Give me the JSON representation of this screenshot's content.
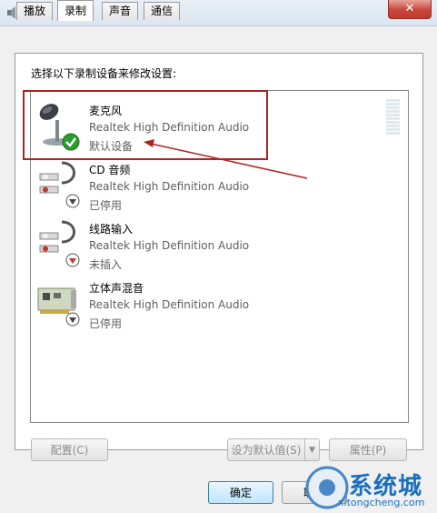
{
  "window": {
    "title": "声音",
    "close_symbol": "✕"
  },
  "tabs": [
    {
      "label": "播放"
    },
    {
      "label": "录制"
    },
    {
      "label": "声音"
    },
    {
      "label": "通信"
    }
  ],
  "active_tab": "录制",
  "instruction": "选择以下录制设备来修改设置:",
  "devices": [
    {
      "name": "麦克风",
      "driver": "Realtek High Definition Audio",
      "status": "默认设备",
      "icon": "microphone-icon",
      "badge": "checkmark-badge"
    },
    {
      "name": "CD 音频",
      "driver": "Realtek High Definition Audio",
      "status": "已停用",
      "icon": "audio-cable-icon",
      "badge": "disabled-badge"
    },
    {
      "name": "线路输入",
      "driver": "Realtek High Definition Audio",
      "status": "未插入",
      "icon": "audio-cable-icon",
      "badge": "unplugged-badge"
    },
    {
      "name": "立体声混音",
      "driver": "Realtek High Definition Audio",
      "status": "已停用",
      "icon": "sound-card-icon",
      "badge": "disabled-badge"
    }
  ],
  "buttons": {
    "configure": "配置(C)",
    "set_default": "设为默认值(S)",
    "properties": "属性(P)",
    "ok": "确定",
    "cancel": "取消"
  },
  "watermark": {
    "text": "系统城",
    "url": "xitongcheng.com"
  },
  "colors": {
    "highlight": "#b22222",
    "check": "#2e9b2e",
    "accent": "#3c7fb1"
  }
}
